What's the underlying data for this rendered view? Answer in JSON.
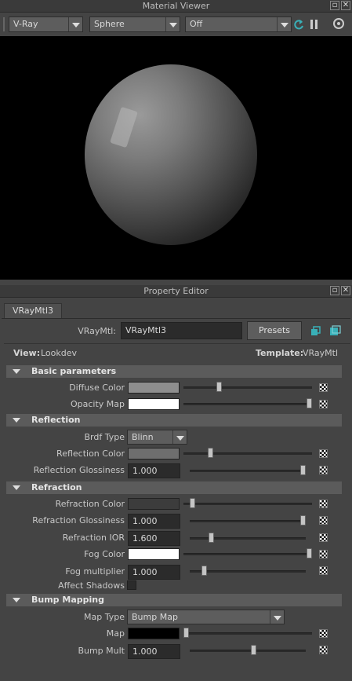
{
  "material_viewer": {
    "title": "Material Viewer",
    "renderer": "V-Ray",
    "shape": "Sphere",
    "mode": "Off"
  },
  "property_editor": {
    "title": "Property Editor",
    "tab": "VRayMtl3",
    "node_label": "VRayMtl:",
    "node_name": "VRayMtl3",
    "presets_label": "Presets",
    "view_label": "View:",
    "view_value": "Lookdev",
    "template_label": "Template:",
    "template_value": "VRayMtl"
  },
  "basic": {
    "header": "Basic parameters",
    "diffuse_color_label": "Diffuse Color",
    "diffuse_color": "#8e8e8e",
    "diffuse_level": 0.27,
    "opacity_map_label": "Opacity Map",
    "opacity_color": "#ffffff",
    "opacity_level": 1.0
  },
  "reflection": {
    "header": "Reflection",
    "brdf_type_label": "Brdf Type",
    "brdf_type": "Blinn",
    "reflection_color_label": "Reflection Color",
    "reflection_color": "#6e6e6e",
    "reflection_color_level": 0.2,
    "reflection_glossiness_label": "Reflection Glossiness",
    "reflection_glossiness": "1.000"
  },
  "refraction": {
    "header": "Refraction",
    "refraction_color_label": "Refraction Color",
    "refraction_color": "#3c3c3c",
    "refraction_color_level": 0.05,
    "refraction_glossiness_label": "Refraction Glossiness",
    "refraction_glossiness": "1.000",
    "refraction_ior_label": "Refraction IOR",
    "refraction_ior": "1.600",
    "fog_color_label": "Fog Color",
    "fog_color": "#ffffff",
    "fog_color_level": 1.0,
    "fog_multiplier_label": "Fog multiplier",
    "fog_multiplier": "1.000",
    "affect_shadows_label": "Affect Shadows",
    "affect_shadows": false
  },
  "bump": {
    "header": "Bump Mapping",
    "map_type_label": "Map Type",
    "map_type": "Bump Map",
    "map_label": "Map",
    "map_color": "#000000",
    "bump_mult_label": "Bump Mult",
    "bump_mult": "1.000"
  }
}
